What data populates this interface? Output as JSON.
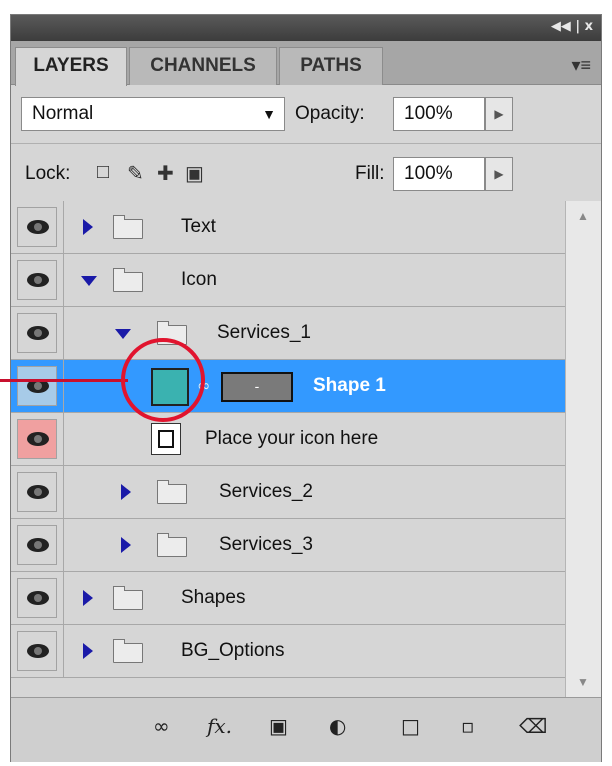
{
  "titlebar": {
    "controls": "◀◀ | x"
  },
  "tabs": [
    {
      "label": "LAYERS",
      "active": true
    },
    {
      "label": "CHANNELS",
      "active": false
    },
    {
      "label": "PATHS",
      "active": false
    }
  ],
  "toolbar": {
    "blend_mode": "Normal",
    "opacity_label": "Opacity:",
    "opacity_value": "100%",
    "lock_label": "Lock:",
    "fill_label": "Fill:",
    "fill_value": "100%"
  },
  "layers": [
    {
      "name": "Text",
      "type": "group",
      "expanded": false,
      "indent": 0
    },
    {
      "name": "Icon",
      "type": "group",
      "expanded": true,
      "indent": 0
    },
    {
      "name": "Services_1",
      "type": "group",
      "expanded": true,
      "indent": 1
    },
    {
      "name": "Shape 1",
      "type": "shape",
      "selected": true,
      "indent": 2
    },
    {
      "name": "Place your icon here",
      "type": "smart",
      "indent": 2
    },
    {
      "name": "Services_2",
      "type": "group",
      "expanded": false,
      "indent": 1
    },
    {
      "name": "Services_3",
      "type": "group",
      "expanded": false,
      "indent": 1
    },
    {
      "name": "Shapes",
      "type": "group",
      "expanded": false,
      "indent": 0
    },
    {
      "name": "BG_Options",
      "type": "group",
      "expanded": false,
      "indent": 0
    }
  ],
  "colors": {
    "selected_row": "#3399ff",
    "shape_fill": "#3ab2b0",
    "callout": "#e1142e"
  },
  "icons": [
    "link-icon",
    "fx-icon",
    "add-mask-icon",
    "adjustment-layer-icon",
    "new-group-icon",
    "new-layer-icon",
    "trash-icon"
  ]
}
